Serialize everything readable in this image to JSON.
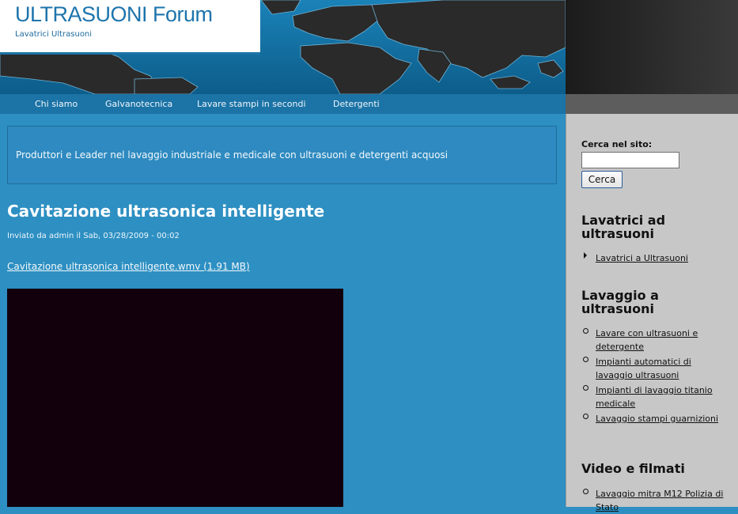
{
  "site": {
    "title": "ULTRASUONI Forum",
    "subtitle": "Lavatrici Ultrasuoni"
  },
  "nav": {
    "items": [
      {
        "label": "Chi siamo"
      },
      {
        "label": "Galvanotecnica"
      },
      {
        "label": "Lavare stampi in secondi"
      },
      {
        "label": "Detergenti"
      }
    ]
  },
  "mission": "Produttori e Leader nel lavaggio industriale e medicale con ultrasuoni e detergenti acquosi",
  "post": {
    "title": "Cavitazione ultrasonica intelligente",
    "meta": "Inviato da admin il Sab, 03/28/2009 - 00:02",
    "attachment": "Cavitazione ultrasonica intelligente.wmv (1.91 MB)"
  },
  "sidebar": {
    "search_label": "Cerca nel sito:",
    "search_value": "",
    "search_button": "Cerca",
    "blocks": [
      {
        "title": "Lavatrici ad ultrasuoni",
        "links": [
          "Lavatrici a Ultrasuoni"
        ]
      },
      {
        "title": "Lavaggio a ultrasuoni",
        "links": [
          "Lavare con ultrasuoni e detergente",
          "Impianti automatici di lavaggio ultrasuoni",
          "Impianti di lavaggio titanio medicale",
          "Lavaggio stampi guarnizioni"
        ]
      },
      {
        "title": "Video e filmati",
        "links": [
          "Lavaggio mitra M12 Polizia di Stato"
        ]
      }
    ]
  },
  "colors": {
    "page_bg": "#2d8fc2",
    "nav_bg": "#1b73a6",
    "sidebar_bg": "#c7c7c7",
    "brand_text": "#1d74ac",
    "video_bg": "#12000d"
  },
  "icons": {
    "header_graphic": "world-map",
    "sidebar_bullet_first": "triangle-bullet-icon",
    "sidebar_bullet_rest": "circle-bullet-icon"
  }
}
